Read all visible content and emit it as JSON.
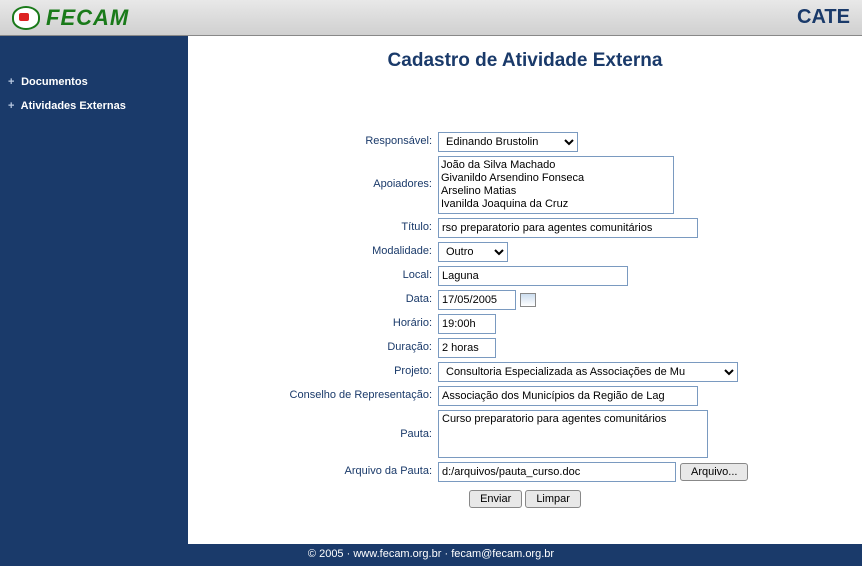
{
  "header": {
    "logo_text": "FECAM",
    "app_title": "CATE"
  },
  "sidebar": {
    "items": [
      {
        "label": "Documentos"
      },
      {
        "label": "Atividades Externas"
      }
    ]
  },
  "page": {
    "title": "Cadastro de Atividade Externa"
  },
  "form": {
    "labels": {
      "responsavel": "Responsável:",
      "apoiadores": "Apoiadores:",
      "titulo": "Título:",
      "modalidade": "Modalidade:",
      "local": "Local:",
      "data": "Data:",
      "horario": "Horário:",
      "duracao": "Duração:",
      "projeto": "Projeto:",
      "conselho": "Conselho de Representação:",
      "pauta": "Pauta:",
      "arquivo": "Arquivo da Pauta:"
    },
    "responsavel": {
      "selected": "Edinando Brustolin"
    },
    "apoiadores": [
      "João da Silva Machado",
      "Givanildo Arsendino Fonseca",
      "Arselino Matias",
      "Ivanilda Joaquina da Cruz"
    ],
    "titulo": "rso preparatorio para agentes comunitários",
    "modalidade": {
      "selected": "Outro"
    },
    "local": "Laguna",
    "data": "17/05/2005",
    "horario": "19:00h",
    "duracao": "2 horas",
    "projeto": {
      "selected": "Consultoria Especializada as Associações de Mu"
    },
    "conselho": "Associação dos Municípios da Região de Lag",
    "pauta": "Curso preparatorio para agentes comunitários",
    "arquivo_path": "d:/arquivos/pauta_curso.doc",
    "buttons": {
      "arquivo": "Arquivo...",
      "enviar": "Enviar",
      "limpar": "Limpar"
    }
  },
  "footer": {
    "copyright": "© 2005 ",
    "sep": " · ",
    "site": "www.fecam.org.br",
    "email": "fecam@fecam.org.br"
  }
}
